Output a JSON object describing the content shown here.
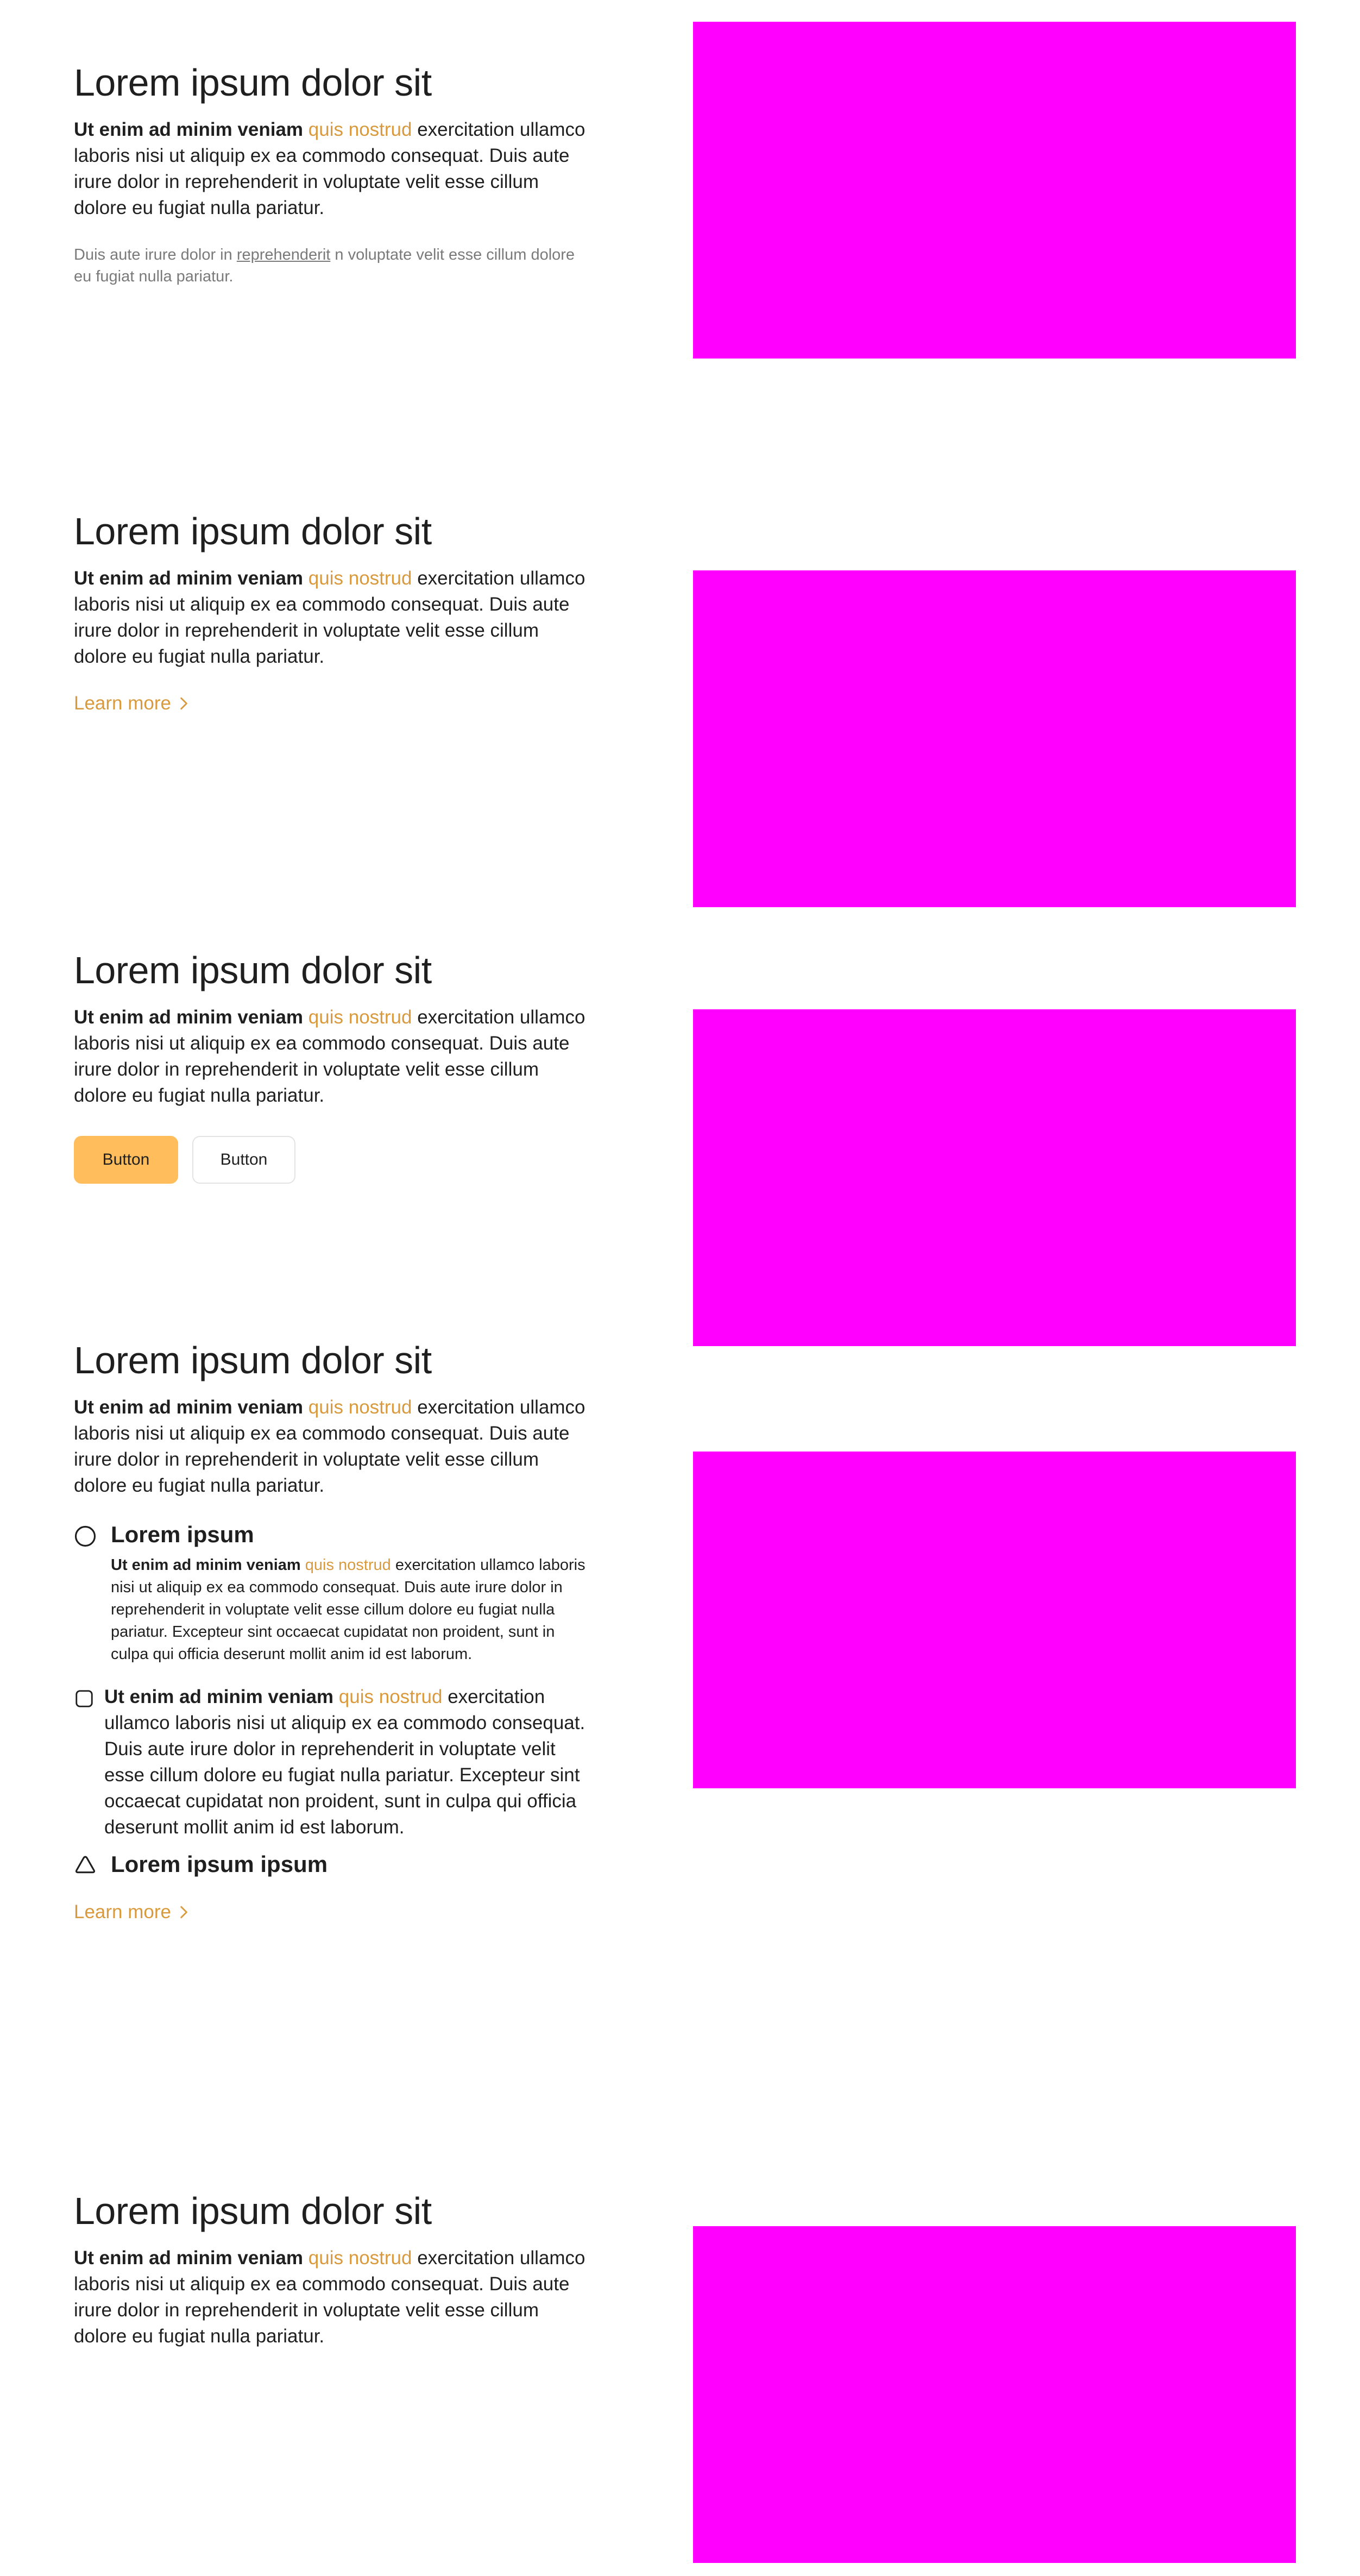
{
  "colors": {
    "accent": "#d99a3e",
    "primary_button": "#ffbd5c",
    "placeholder": "#ff00ff",
    "text": "#1f1f1f",
    "muted": "#7a7a7a"
  },
  "common": {
    "heading": "Lorem ipsum dolor sit",
    "lead_bold": "Ut enim ad minim veniam",
    "lead_accent": "quis nostrud",
    "lead_rest": "exercitation ullamco laboris nisi ut aliquip ex ea commodo consequat. Duis aute irure dolor in reprehenderit in voluptate velit esse cillum dolore eu fugiat nulla pariatur.",
    "learn_more": "Learn more",
    "chevron_icon": "chevron-right-icon"
  },
  "section1": {
    "sub_before": "Duis aute irure dolor in",
    "sub_link": "reprehenderit",
    "sub_after": "n voluptate velit esse cillum dolore eu fugiat nulla pariatur."
  },
  "section3": {
    "primary_button": "Button",
    "secondary_button": "Button"
  },
  "section4": {
    "feature1": {
      "icon": "circle-icon",
      "title": "Lorem ipsum",
      "body_bold": "Ut enim ad minim veniam",
      "body_accent": "quis nostrud",
      "body_rest": "exercitation ullamco laboris nisi ut aliquip ex ea commodo consequat. Duis aute irure dolor in reprehenderit in voluptate velit esse cillum dolore eu fugiat nulla pariatur. Excepteur sint occaecat cupidatat non proident, sunt in culpa qui officia deserunt mollit anim id est laborum."
    },
    "feature2": {
      "icon": "rounded-square-icon",
      "body_bold": "Ut enim ad minim veniam",
      "body_accent": "quis nostrud",
      "body_rest": "exercitation ullamco laboris nisi ut aliquip ex ea commodo consequat. Duis aute irure dolor in reprehenderit in voluptate velit esse cillum dolore eu fugiat nulla pariatur. Excepteur sint occaecat cupidatat non proident, sunt in culpa qui officia deserunt mollit anim id est laborum."
    },
    "feature3": {
      "icon": "triangle-icon",
      "title": "Lorem ipsum ipsum"
    }
  }
}
